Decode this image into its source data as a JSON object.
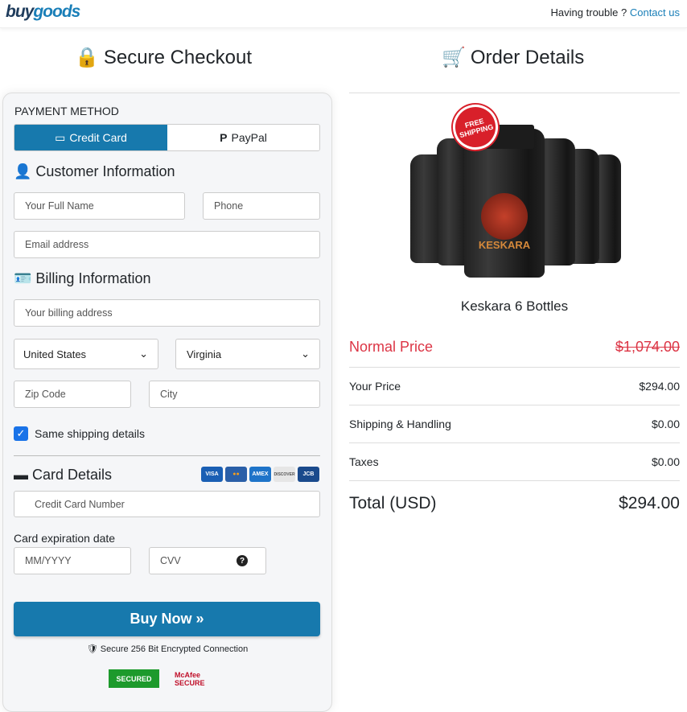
{
  "header": {
    "logo_left": "buy",
    "logo_right": "goods",
    "trouble": "Having trouble ?",
    "contact": "Contact us"
  },
  "checkout": {
    "title": "Secure Checkout",
    "payment_method": "PAYMENT METHOD",
    "tabs": [
      "Credit Card",
      "PayPal"
    ],
    "active_tab": "Credit Card",
    "customer_title": "Customer Information",
    "full_name_ph": "Your Full Name",
    "phone_ph": "Phone",
    "email_ph": "Email address",
    "billing_title": "Billing Information",
    "address_ph": "Your billing address",
    "country": "United States",
    "state": "Virginia",
    "zip_ph": "Zip Code",
    "city_ph": "City",
    "same_shipping": "Same shipping details",
    "same_shipping_checked": true,
    "card_title": "Card Details",
    "card_logos": [
      "VISA",
      "MC",
      "AMEX",
      "DISCOVER",
      "JCB"
    ],
    "card_number_ph": "Credit Card Number",
    "exp_label": "Card expiration date",
    "exp_ph": "MM/YYYY",
    "cvv_ph": "CVV",
    "buy_label": "Buy Now »",
    "secure_text": "Secure 256 Bit Encrypted Connection",
    "badges": [
      "SECURED",
      "McAfee SECURE"
    ]
  },
  "order": {
    "title": "Order Details",
    "free_shipping": "FREE SHIPPING",
    "brand": "KESKARA",
    "product": "Keskara 6 Bottles",
    "normal_label": "Normal Price",
    "normal_price": "$1,074.00",
    "your_label": "Your Price",
    "your_price": "$294.00",
    "ship_label": "Shipping & Handling",
    "ship_price": "$0.00",
    "tax_label": "Taxes",
    "tax_price": "$0.00",
    "total_label": "Total (USD)",
    "total_price": "$294.00"
  },
  "colors": {
    "accent": "#1779ad",
    "red": "#dc3545"
  }
}
